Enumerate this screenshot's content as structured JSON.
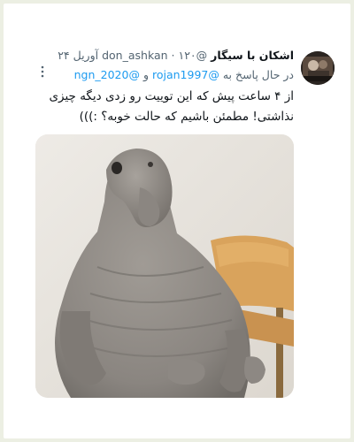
{
  "tweet": {
    "author_name": "اشکان با سیگار",
    "author_handle": "@don_ashkan",
    "separator": "·",
    "date": "۱۲۰ آوریل ۲۴",
    "replying_prefix": "در حال پاسخ به",
    "reply_mention_1": "@rojan1997",
    "reply_conjunction": "و",
    "reply_mention_2": "@ngn_2020",
    "text": "از ۴ ساعت پیش که این توییت رو زدی دیگه چیزی نذاشتی! مطمئن باشیم که حالت خوبه؟ :)))",
    "more_icon": "more-vertical-icon",
    "colors": {
      "link": "#1d9bf0",
      "muted": "#536471",
      "text": "#0f1419"
    }
  }
}
